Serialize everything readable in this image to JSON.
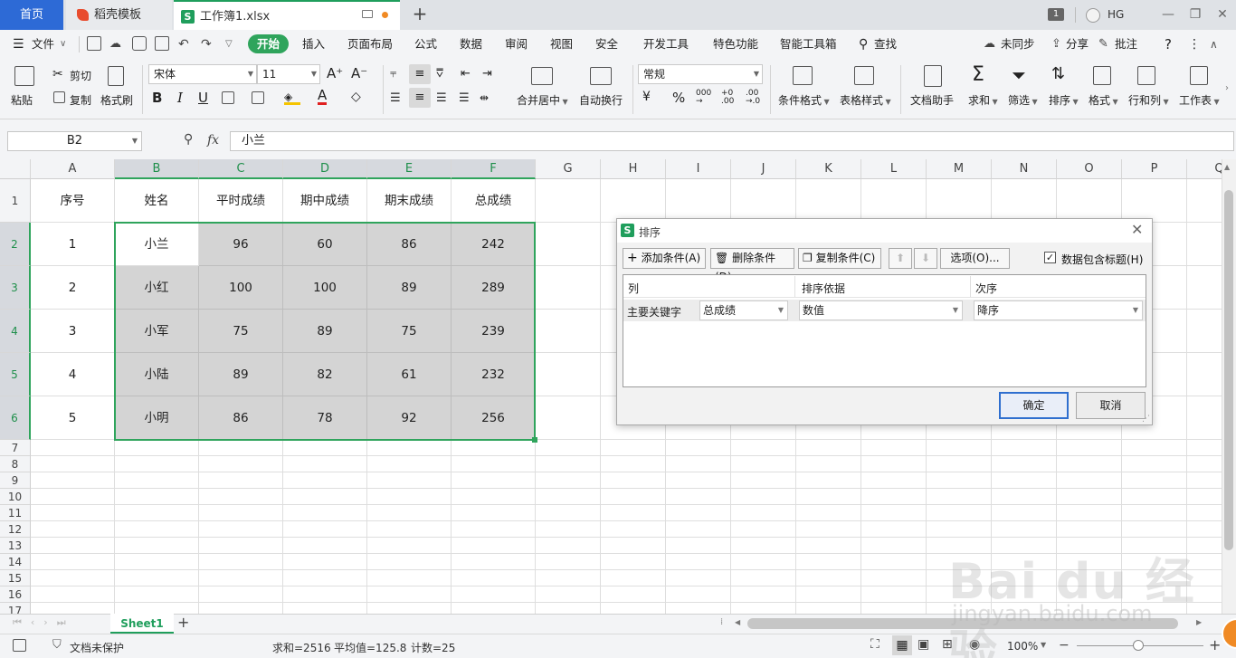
{
  "titlebar": {
    "tabs": [
      {
        "label": "首页"
      },
      {
        "label": "稻壳模板"
      },
      {
        "label": "工作簿1.xlsx"
      }
    ],
    "count_badge": "1",
    "user": "HG"
  },
  "menu": {
    "file": "文件",
    "items": [
      "开始",
      "插入",
      "页面布局",
      "公式",
      "数据",
      "审阅",
      "视图",
      "安全",
      "开发工具",
      "特色功能",
      "智能工具箱",
      "查找"
    ],
    "sync": "未同步",
    "share": "分享",
    "comment": "批注",
    "help": "?"
  },
  "ribbon": {
    "paste": "粘贴",
    "cut": "剪切",
    "copy": "复制",
    "format_painter": "格式刷",
    "font_name": "宋体",
    "font_size": "11",
    "merge_center": "合并居中",
    "wrap_text": "自动换行",
    "number_format": "常规",
    "cond_format": "条件格式",
    "table_style": "表格样式",
    "doc_assistant": "文档助手",
    "sum": "求和",
    "filter": "筛选",
    "sort": "排序",
    "format": "格式",
    "rows_cols": "行和列",
    "worksheet": "工作表",
    "bold": "B",
    "italic": "I",
    "underline": "U",
    "font_color": "A",
    "percent": "%"
  },
  "formula_bar": {
    "name_box": "B2",
    "fx": "fx",
    "value": "小兰"
  },
  "sheet": {
    "columns": [
      "A",
      "B",
      "C",
      "D",
      "E",
      "F",
      "G",
      "H",
      "I",
      "J",
      "K",
      "L",
      "M",
      "N",
      "O",
      "P",
      "Q"
    ],
    "header_row": [
      "序号",
      "姓名",
      "平时成绩",
      "期中成绩",
      "期末成绩",
      "总成绩"
    ],
    "rows": [
      [
        "1",
        "小兰",
        "96",
        "60",
        "86",
        "242"
      ],
      [
        "2",
        "小红",
        "100",
        "100",
        "89",
        "289"
      ],
      [
        "3",
        "小军",
        "75",
        "89",
        "75",
        "239"
      ],
      [
        "4",
        "小陆",
        "89",
        "82",
        "61",
        "232"
      ],
      [
        "5",
        "小明",
        "86",
        "78",
        "92",
        "256"
      ]
    ],
    "row_numbers": [
      "1",
      "2",
      "3",
      "4",
      "5",
      "6",
      "7",
      "8",
      "9",
      "10",
      "11",
      "12",
      "13",
      "14",
      "15",
      "16",
      "17"
    ],
    "selected_range": "B2:F6",
    "active_cell": "B2"
  },
  "sheet_tabs": {
    "active": "Sheet1",
    "add": "+"
  },
  "status": {
    "protection": "文档未保护",
    "sum": "求和=2516",
    "average": "平均值=125.8",
    "count": "计数=25",
    "zoom": "100%"
  },
  "sort_dialog": {
    "title": "排序",
    "add_condition": "添加条件(A)",
    "delete_condition": "删除条件(D)",
    "copy_condition": "复制条件(C)",
    "options": "选项(O)...",
    "has_header": "数据包含标题(H)",
    "has_header_checked": true,
    "col_header": "列",
    "basis_header": "排序依据",
    "order_header": "次序",
    "primary_key_label": "主要关键字",
    "primary_key_value": "总成绩",
    "basis_value": "数值",
    "order_value": "降序",
    "ok": "确定",
    "cancel": "取消"
  },
  "watermark": {
    "brand": "Bai du 经验",
    "url": "jingyan.baidu.com"
  },
  "colors": {
    "accent_green": "#2fa45c",
    "home_tab_blue": "#2d6ad6",
    "ok_border": "#2f6fcf"
  }
}
